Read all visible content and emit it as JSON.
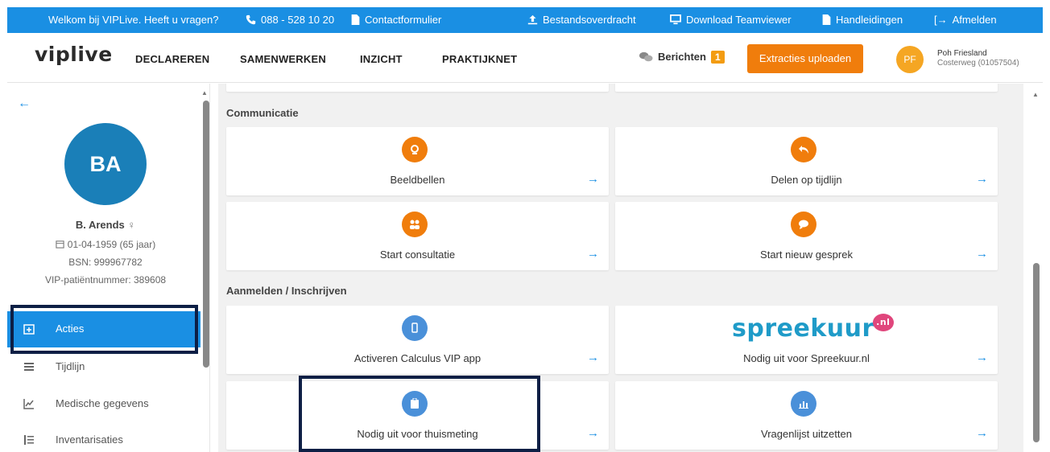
{
  "topbar": {
    "welcome": "Welkom bij VIPLive. Heeft u vragen?",
    "phone": "088 - 528 10 20",
    "contact": "Contactformulier",
    "transfer": "Bestandsoverdracht",
    "teamviewer": "Download Teamviewer",
    "manuals": "Handleidingen",
    "logout": "Afmelden"
  },
  "header": {
    "logo": "viplive",
    "nav": [
      "DECLAREREN",
      "SAMENWERKEN",
      "INZICHT",
      "PRAKTIJKNET"
    ],
    "messages_label": "Berichten",
    "messages_count": "1",
    "upload_button": "Extracties uploaden",
    "user_initials": "PF",
    "user_name": "Poh Friesland",
    "user_location": "Costerweg (01057504)"
  },
  "patient": {
    "initials": "BA",
    "name": "B. Arends",
    "gender_symbol": "♀",
    "dob": "01-04-1959  (65 jaar)",
    "bsn": "BSN: 999967782",
    "vip_number": "VIP-patiëntnummer: 389608"
  },
  "sidebar": {
    "items": [
      {
        "label": "Acties",
        "icon": "calendar-plus-icon",
        "active": true
      },
      {
        "label": "Tijdlijn",
        "icon": "list-icon",
        "active": false
      },
      {
        "label": "Medische gegevens",
        "icon": "chart-line-icon",
        "active": false
      },
      {
        "label": "Inventarisaties",
        "icon": "list-ordered-icon",
        "active": false
      }
    ]
  },
  "main": {
    "sections": [
      {
        "title": "Communicatie",
        "cards": [
          {
            "label": "Beeldbellen",
            "icon": "webcam-icon",
            "color": "#f07d0c"
          },
          {
            "label": "Delen op tijdlijn",
            "icon": "reply-icon",
            "color": "#f07d0c"
          },
          {
            "label": "Start consultatie",
            "icon": "users-icon",
            "color": "#f07d0c"
          },
          {
            "label": "Start nieuw gesprek",
            "icon": "chat-icon",
            "color": "#f07d0c"
          }
        ]
      },
      {
        "title": "Aanmelden / Inschrijven",
        "cards": [
          {
            "label": "Activeren Calculus VIP app",
            "icon": "mobile-icon",
            "color": "#4a90d9"
          },
          {
            "label": "Nodig uit voor Spreekuur.nl",
            "icon": "spreekuur-logo",
            "logo_text": "spreekuur",
            "logo_badge": ".nl",
            "color": "#1f9bc8"
          },
          {
            "label": "Nodig uit voor thuismeting",
            "icon": "clipboard-icon",
            "color": "#4a90d9"
          },
          {
            "label": "Vragenlijst uitzetten",
            "icon": "bar-chart-icon",
            "color": "#4a90d9"
          }
        ]
      }
    ]
  },
  "colors": {
    "primary_blue": "#1a8fe3",
    "orange": "#f07d0c",
    "highlight_box": "#0d1f45"
  }
}
